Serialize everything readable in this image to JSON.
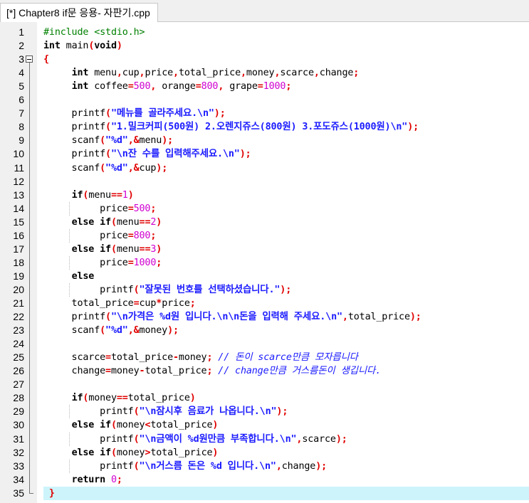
{
  "tab": {
    "title": "[*] Chapter8 if문 응용- 자판기.cpp"
  },
  "editor": {
    "highlighted_line": 35,
    "lines": [
      {
        "num": "1",
        "tokens": [
          {
            "t": "#include <stdio.h>",
            "c": "pp"
          }
        ]
      },
      {
        "num": "2",
        "tokens": [
          {
            "t": "int",
            "c": "kw"
          },
          {
            "t": " main",
            "c": "id"
          },
          {
            "t": "(",
            "c": "sym"
          },
          {
            "t": "void",
            "c": "kw"
          },
          {
            "t": ")",
            "c": "sym"
          }
        ]
      },
      {
        "num": "3",
        "tokens": [
          {
            "t": "{",
            "c": "sym"
          }
        ]
      },
      {
        "num": "4",
        "tokens": [
          {
            "t": "     "
          },
          {
            "t": "int",
            "c": "kw"
          },
          {
            "t": " menu",
            "c": "id"
          },
          {
            "t": ",",
            "c": "sym"
          },
          {
            "t": "cup",
            "c": "id"
          },
          {
            "t": ",",
            "c": "sym"
          },
          {
            "t": "price",
            "c": "id"
          },
          {
            "t": ",",
            "c": "sym"
          },
          {
            "t": "total_price",
            "c": "id"
          },
          {
            "t": ",",
            "c": "sym"
          },
          {
            "t": "money",
            "c": "id"
          },
          {
            "t": ",",
            "c": "sym"
          },
          {
            "t": "scarce",
            "c": "id"
          },
          {
            "t": ",",
            "c": "sym"
          },
          {
            "t": "change",
            "c": "id"
          },
          {
            "t": ";",
            "c": "sym"
          }
        ]
      },
      {
        "num": "5",
        "tokens": [
          {
            "t": "     "
          },
          {
            "t": "int",
            "c": "kw"
          },
          {
            "t": " coffee",
            "c": "id"
          },
          {
            "t": "=",
            "c": "sym"
          },
          {
            "t": "500",
            "c": "num"
          },
          {
            "t": ",",
            "c": "sym"
          },
          {
            "t": " orange",
            "c": "id"
          },
          {
            "t": "=",
            "c": "sym"
          },
          {
            "t": "800",
            "c": "num"
          },
          {
            "t": ",",
            "c": "sym"
          },
          {
            "t": " grape",
            "c": "id"
          },
          {
            "t": "=",
            "c": "sym"
          },
          {
            "t": "1000",
            "c": "num"
          },
          {
            "t": ";",
            "c": "sym"
          }
        ]
      },
      {
        "num": "6",
        "tokens": []
      },
      {
        "num": "7",
        "tokens": [
          {
            "t": "     printf",
            "c": "id"
          },
          {
            "t": "(",
            "c": "sym"
          },
          {
            "t": "\"메뉴를 골라주세요.\\n\"",
            "c": "str"
          },
          {
            "t": ");",
            "c": "sym"
          }
        ]
      },
      {
        "num": "8",
        "tokens": [
          {
            "t": "     printf",
            "c": "id"
          },
          {
            "t": "(",
            "c": "sym"
          },
          {
            "t": "\"1.밀크커피(500원) 2.오렌지쥬스(800원) 3.포도쥬스(1000원)\\n\"",
            "c": "str"
          },
          {
            "t": ");",
            "c": "sym"
          }
        ]
      },
      {
        "num": "9",
        "tokens": [
          {
            "t": "     scanf",
            "c": "id"
          },
          {
            "t": "(",
            "c": "sym"
          },
          {
            "t": "\"%d\"",
            "c": "str"
          },
          {
            "t": ",&",
            "c": "sym"
          },
          {
            "t": "menu",
            "c": "id"
          },
          {
            "t": ");",
            "c": "sym"
          }
        ]
      },
      {
        "num": "10",
        "tokens": [
          {
            "t": "     printf",
            "c": "id"
          },
          {
            "t": "(",
            "c": "sym"
          },
          {
            "t": "\"\\n잔 수를 입력해주세요.\\n\"",
            "c": "str"
          },
          {
            "t": ");",
            "c": "sym"
          }
        ]
      },
      {
        "num": "11",
        "tokens": [
          {
            "t": "     scanf",
            "c": "id"
          },
          {
            "t": "(",
            "c": "sym"
          },
          {
            "t": "\"%d\"",
            "c": "str"
          },
          {
            "t": ",&",
            "c": "sym"
          },
          {
            "t": "cup",
            "c": "id"
          },
          {
            "t": ");",
            "c": "sym"
          }
        ]
      },
      {
        "num": "12",
        "tokens": []
      },
      {
        "num": "13",
        "tokens": [
          {
            "t": "     "
          },
          {
            "t": "if",
            "c": "kw"
          },
          {
            "t": "(",
            "c": "sym"
          },
          {
            "t": "menu",
            "c": "id"
          },
          {
            "t": "==",
            "c": "sym"
          },
          {
            "t": "1",
            "c": "num"
          },
          {
            "t": ")",
            "c": "sym"
          }
        ]
      },
      {
        "num": "14",
        "tokens": [
          {
            "t": "          price",
            "c": "id"
          },
          {
            "t": "=",
            "c": "sym"
          },
          {
            "t": "500",
            "c": "num"
          },
          {
            "t": ";",
            "c": "sym"
          }
        ]
      },
      {
        "num": "15",
        "tokens": [
          {
            "t": "     "
          },
          {
            "t": "else if",
            "c": "kw"
          },
          {
            "t": "(",
            "c": "sym"
          },
          {
            "t": "menu",
            "c": "id"
          },
          {
            "t": "==",
            "c": "sym"
          },
          {
            "t": "2",
            "c": "num"
          },
          {
            "t": ")",
            "c": "sym"
          }
        ]
      },
      {
        "num": "16",
        "tokens": [
          {
            "t": "          price",
            "c": "id"
          },
          {
            "t": "=",
            "c": "sym"
          },
          {
            "t": "800",
            "c": "num"
          },
          {
            "t": ";",
            "c": "sym"
          }
        ]
      },
      {
        "num": "17",
        "tokens": [
          {
            "t": "     "
          },
          {
            "t": "else if",
            "c": "kw"
          },
          {
            "t": "(",
            "c": "sym"
          },
          {
            "t": "menu",
            "c": "id"
          },
          {
            "t": "==",
            "c": "sym"
          },
          {
            "t": "3",
            "c": "num"
          },
          {
            "t": ")",
            "c": "sym"
          }
        ]
      },
      {
        "num": "18",
        "tokens": [
          {
            "t": "          price",
            "c": "id"
          },
          {
            "t": "=",
            "c": "sym"
          },
          {
            "t": "1000",
            "c": "num"
          },
          {
            "t": ";",
            "c": "sym"
          }
        ]
      },
      {
        "num": "19",
        "tokens": [
          {
            "t": "     "
          },
          {
            "t": "else",
            "c": "kw"
          }
        ]
      },
      {
        "num": "20",
        "tokens": [
          {
            "t": "          printf",
            "c": "id"
          },
          {
            "t": "(",
            "c": "sym"
          },
          {
            "t": "\"잘못된 번호를 선택하셨습니다.\"",
            "c": "str"
          },
          {
            "t": ");",
            "c": "sym"
          }
        ]
      },
      {
        "num": "21",
        "tokens": [
          {
            "t": "     total_price",
            "c": "id"
          },
          {
            "t": "=",
            "c": "sym"
          },
          {
            "t": "cup",
            "c": "id"
          },
          {
            "t": "*",
            "c": "sym"
          },
          {
            "t": "price",
            "c": "id"
          },
          {
            "t": ";",
            "c": "sym"
          }
        ]
      },
      {
        "num": "22",
        "tokens": [
          {
            "t": "     printf",
            "c": "id"
          },
          {
            "t": "(",
            "c": "sym"
          },
          {
            "t": "\"\\n가격은 %d원 입니다.\\n\\n돈을 입력해 주세요.\\n\"",
            "c": "str"
          },
          {
            "t": ",",
            "c": "sym"
          },
          {
            "t": "total_price",
            "c": "id"
          },
          {
            "t": ");",
            "c": "sym"
          }
        ]
      },
      {
        "num": "23",
        "tokens": [
          {
            "t": "     scanf",
            "c": "id"
          },
          {
            "t": "(",
            "c": "sym"
          },
          {
            "t": "\"%d\"",
            "c": "str"
          },
          {
            "t": ",&",
            "c": "sym"
          },
          {
            "t": "money",
            "c": "id"
          },
          {
            "t": ");",
            "c": "sym"
          }
        ]
      },
      {
        "num": "24",
        "tokens": []
      },
      {
        "num": "25",
        "tokens": [
          {
            "t": "     scarce",
            "c": "id"
          },
          {
            "t": "=",
            "c": "sym"
          },
          {
            "t": "total_price",
            "c": "id"
          },
          {
            "t": "-",
            "c": "sym"
          },
          {
            "t": "money",
            "c": "id"
          },
          {
            "t": ";",
            "c": "sym"
          },
          {
            "t": " // 돈이 scarce만큼 모자릅니다",
            "c": "cmt"
          }
        ]
      },
      {
        "num": "26",
        "tokens": [
          {
            "t": "     change",
            "c": "id"
          },
          {
            "t": "=",
            "c": "sym"
          },
          {
            "t": "money",
            "c": "id"
          },
          {
            "t": "-",
            "c": "sym"
          },
          {
            "t": "total_price",
            "c": "id"
          },
          {
            "t": ";",
            "c": "sym"
          },
          {
            "t": " // change만큼 거스름돈이 생깁니다.",
            "c": "cmt"
          }
        ]
      },
      {
        "num": "27",
        "tokens": []
      },
      {
        "num": "28",
        "tokens": [
          {
            "t": "     "
          },
          {
            "t": "if",
            "c": "kw"
          },
          {
            "t": "(",
            "c": "sym"
          },
          {
            "t": "money",
            "c": "id"
          },
          {
            "t": "==",
            "c": "sym"
          },
          {
            "t": "total_price",
            "c": "id"
          },
          {
            "t": ")",
            "c": "sym"
          }
        ]
      },
      {
        "num": "29",
        "tokens": [
          {
            "t": "          printf",
            "c": "id"
          },
          {
            "t": "(",
            "c": "sym"
          },
          {
            "t": "\"\\n잠시후 음료가 나옵니다.\\n\"",
            "c": "str"
          },
          {
            "t": ");",
            "c": "sym"
          }
        ]
      },
      {
        "num": "30",
        "tokens": [
          {
            "t": "     "
          },
          {
            "t": "else if",
            "c": "kw"
          },
          {
            "t": "(",
            "c": "sym"
          },
          {
            "t": "money",
            "c": "id"
          },
          {
            "t": "<",
            "c": "sym"
          },
          {
            "t": "total_price",
            "c": "id"
          },
          {
            "t": ")",
            "c": "sym"
          }
        ]
      },
      {
        "num": "31",
        "tokens": [
          {
            "t": "          printf",
            "c": "id"
          },
          {
            "t": "(",
            "c": "sym"
          },
          {
            "t": "\"\\n금액이 %d원만큼 부족합니다.\\n\"",
            "c": "str"
          },
          {
            "t": ",",
            "c": "sym"
          },
          {
            "t": "scarce",
            "c": "id"
          },
          {
            "t": ");",
            "c": "sym"
          }
        ]
      },
      {
        "num": "32",
        "tokens": [
          {
            "t": "     "
          },
          {
            "t": "else if",
            "c": "kw"
          },
          {
            "t": "(",
            "c": "sym"
          },
          {
            "t": "money",
            "c": "id"
          },
          {
            "t": ">",
            "c": "sym"
          },
          {
            "t": "total_price",
            "c": "id"
          },
          {
            "t": ")",
            "c": "sym"
          }
        ]
      },
      {
        "num": "33",
        "tokens": [
          {
            "t": "          printf",
            "c": "id"
          },
          {
            "t": "(",
            "c": "sym"
          },
          {
            "t": "\"\\n거스름 돈은 %d 입니다.\\n\"",
            "c": "str"
          },
          {
            "t": ",",
            "c": "sym"
          },
          {
            "t": "change",
            "c": "id"
          },
          {
            "t": ");",
            "c": "sym"
          }
        ]
      },
      {
        "num": "34",
        "tokens": [
          {
            "t": "     "
          },
          {
            "t": "return",
            "c": "kw"
          },
          {
            "t": " "
          },
          {
            "t": "0",
            "c": "num"
          },
          {
            "t": ";",
            "c": "sym"
          }
        ]
      },
      {
        "num": "35",
        "tokens": [
          {
            "t": " "
          },
          {
            "t": "}",
            "c": "sym"
          }
        ]
      }
    ],
    "colors": {
      "keyword": "#000000",
      "preprocessor": "#008000",
      "string": "#1a1aff",
      "number": "#d000d0",
      "symbol": "#e00000",
      "comment": "#1a1aff",
      "current_line": "#cdf4fb",
      "gutter": "#f0f0f0"
    },
    "fold_icon": "minus-box-icon"
  }
}
